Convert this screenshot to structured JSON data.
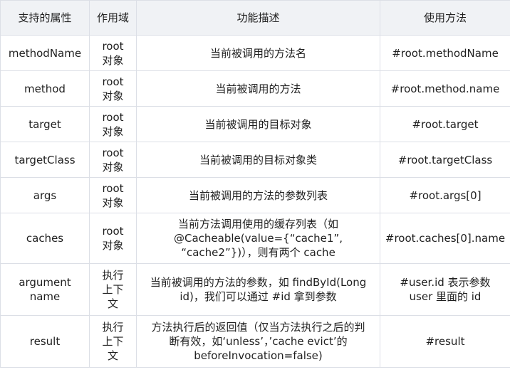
{
  "headers": [
    "支持的属性",
    "作用域",
    "功能描述",
    "使用方法"
  ],
  "rows": [
    {
      "attr": "methodName",
      "scope": "root对象",
      "desc": "当前被调用的方法名",
      "usage": "#root.methodName"
    },
    {
      "attr": "method",
      "scope": "root对象",
      "desc": "当前被调用的方法",
      "usage": "#root.method.name"
    },
    {
      "attr": "target",
      "scope": "root对象",
      "desc": "当前被调用的目标对象",
      "usage": "#root.target"
    },
    {
      "attr": "targetClass",
      "scope": "root对象",
      "desc": "当前被调用的目标对象类",
      "usage": "#root.targetClass"
    },
    {
      "attr": "args",
      "scope": "root对象",
      "desc": "当前被调用的方法的参数列表",
      "usage": "#root.args[0]"
    },
    {
      "attr": "caches",
      "scope": "root对象",
      "desc": "当前方法调用使用的缓存列表（如 @Cacheable(value={“cache1”, “cache2”})），则有两个 cache",
      "usage": "#root.caches[0].name"
    },
    {
      "attr": "argument name",
      "scope": "执行上下文",
      "desc": "当前被调用的方法的参数，如 findById(Long id)，我们可以通过 #id 拿到参数",
      "usage": "#user.id 表示参数 user 里面的 id"
    },
    {
      "attr": "result",
      "scope": "执行上下文",
      "desc": "方法执行后的返回值（仅当方法执行之后的判断有效，如‘unless’，’cache evict’的beforeInvocation=false)",
      "usage": "#result"
    }
  ]
}
